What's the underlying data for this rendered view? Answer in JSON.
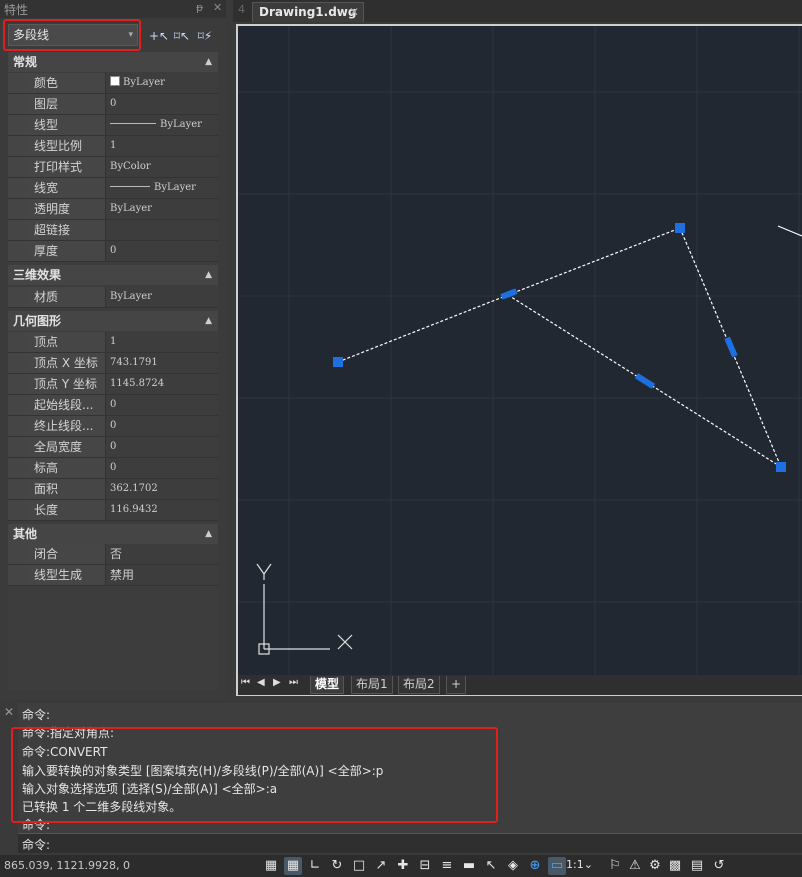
{
  "panel": {
    "title": "特性",
    "pin_glyph": "ᵽ",
    "close_glyph": "✕",
    "selected_type": "多段线",
    "dropdown_glyph": "▾",
    "toolbar": [
      {
        "name": "quick-select-icon",
        "glyph": "+↖"
      },
      {
        "name": "select-objects-icon",
        "glyph": "⌑↖"
      },
      {
        "name": "toggle-pickadd-icon",
        "glyph": "⌑⚡"
      }
    ]
  },
  "sections": {
    "general": {
      "title": "常规",
      "rows": [
        {
          "key": "颜色",
          "value": "ByLayer"
        },
        {
          "key": "图层",
          "value": "0"
        },
        {
          "key": "线型",
          "value": "ByLayer"
        },
        {
          "key": "线型比例",
          "value": "1"
        },
        {
          "key": "打印样式",
          "value": "ByColor"
        },
        {
          "key": "线宽",
          "value": "ByLayer"
        },
        {
          "key": "透明度",
          "value": "ByLayer"
        },
        {
          "key": "超链接",
          "value": ""
        },
        {
          "key": "厚度",
          "value": "0"
        }
      ]
    },
    "threed": {
      "title": "三维效果",
      "rows": [
        {
          "key": "材质",
          "value": "ByLayer"
        }
      ]
    },
    "geometry": {
      "title": "几何图形",
      "rows": [
        {
          "key": "顶点",
          "value": "1"
        },
        {
          "key": "顶点 X 坐标",
          "value": "743.1791"
        },
        {
          "key": "顶点 Y 坐标",
          "value": "1145.8724"
        },
        {
          "key": "起始线段...",
          "value": "0"
        },
        {
          "key": "终止线段...",
          "value": "0"
        },
        {
          "key": "全局宽度",
          "value": "0"
        },
        {
          "key": "标高",
          "value": "0"
        },
        {
          "key": "面积",
          "value": "362.1702"
        },
        {
          "key": "长度",
          "value": "116.9432"
        }
      ]
    },
    "misc": {
      "title": "其他",
      "rows": [
        {
          "key": "闭合",
          "value": "否"
        },
        {
          "key": "线型生成",
          "value": "禁用"
        }
      ]
    }
  },
  "collapse_glyph": "▲",
  "document": {
    "tab_title": "Drawing1.dwg",
    "close_glyph": "✕",
    "prev_glyph": "4"
  },
  "ucs": {
    "x_label": "X",
    "y_label": "Y"
  },
  "layout_tabs": {
    "nav": [
      "⏮",
      "◀",
      "▶",
      "⏭"
    ],
    "tabs": [
      "模型",
      "布局1",
      "布局2",
      "+"
    ],
    "active": "模型"
  },
  "command": {
    "close_glyph": "✕",
    "history": [
      "命令:",
      "命令:指定对角点:",
      "命令:CONVERT",
      "输入要转换的对象类型 [图案填充(H)/多段线(P)/全部(A)] <全部>:p",
      "输入对象选择选项 [选择(S)/全部(A)] <全部>:a",
      "已转换 1 个二维多段线对象。",
      "命令:"
    ],
    "prompt": "命令:"
  },
  "status": {
    "coords": "865.039, 1121.9928, 0",
    "scale": "1:1",
    "scale_arrow": "⌄",
    "icons": [
      {
        "name": "grid-display-icon",
        "glyph": "▦",
        "on": false,
        "blue": false
      },
      {
        "name": "snap-grid-icon",
        "glyph": "▦",
        "on": true,
        "blue": false
      },
      {
        "name": "ortho-icon",
        "glyph": "∟",
        "on": false,
        "blue": false
      },
      {
        "name": "polar-tracking-icon",
        "glyph": "↻",
        "on": false,
        "blue": false
      },
      {
        "name": "object-snap-icon",
        "glyph": "□",
        "on": false,
        "blue": false
      },
      {
        "name": "snap-tracking-icon",
        "glyph": "↗",
        "on": false,
        "blue": false
      },
      {
        "name": "dynamic-ucs-icon",
        "glyph": "✚",
        "on": false,
        "blue": false
      },
      {
        "name": "dynamic-input-icon",
        "glyph": "⊟",
        "on": false,
        "blue": false
      },
      {
        "name": "lineweight-icon",
        "glyph": "≡",
        "on": false,
        "blue": false
      },
      {
        "name": "transparency-icon",
        "glyph": "▬",
        "on": false,
        "blue": false
      },
      {
        "name": "selection-cycling-icon",
        "glyph": "↖",
        "on": false,
        "blue": false
      },
      {
        "name": "layers-icon",
        "glyph": "◈",
        "on": false,
        "blue": false
      },
      {
        "name": "annotation-monitor-icon",
        "glyph": "⊕",
        "on": false,
        "blue": true
      },
      {
        "name": "quick-properties-icon",
        "glyph": "▭",
        "on": true,
        "blue": true
      },
      {
        "name": "annotation-visibility-icon",
        "glyph": "⚐",
        "on": false,
        "blue": false
      },
      {
        "name": "auto-scale-icon",
        "glyph": "⚠",
        "on": false,
        "blue": false
      },
      {
        "name": "workspace-icon",
        "glyph": "⚙",
        "on": false,
        "blue": false
      },
      {
        "name": "isolate-objects-icon",
        "glyph": "▩",
        "on": false,
        "blue": false
      },
      {
        "name": "clean-screen-icon",
        "glyph": "▤",
        "on": false,
        "blue": false
      },
      {
        "name": "customization-icon",
        "glyph": "↺",
        "on": false,
        "blue": false
      }
    ]
  },
  "colors": {
    "canvas_bg": "#212832",
    "grid_line": "#2b3440",
    "grip_blue": "#1e6fe0",
    "selection_line": "#ffffff",
    "highlight_red": "#e02020"
  }
}
